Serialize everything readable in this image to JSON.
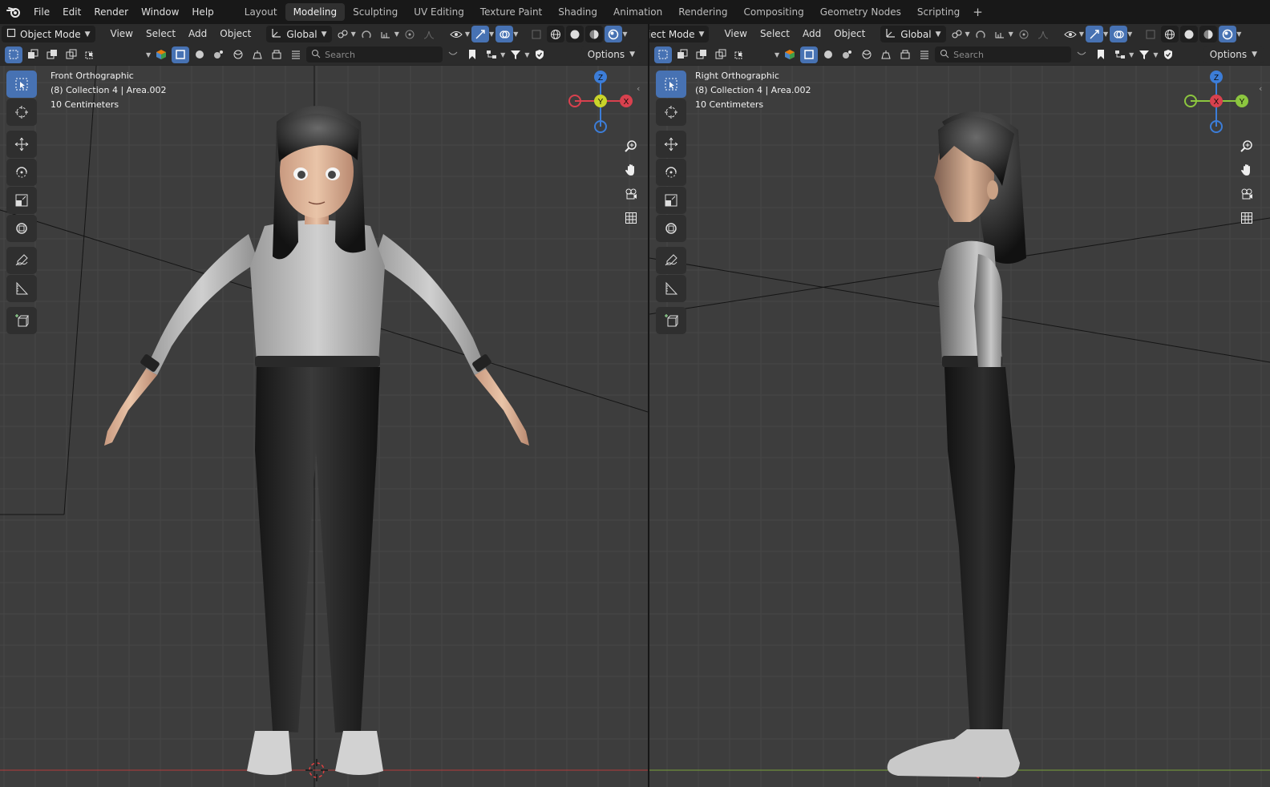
{
  "topbar": {
    "menus": [
      "File",
      "Edit",
      "Render",
      "Window",
      "Help"
    ],
    "workspaces": [
      "Layout",
      "Modeling",
      "Sculpting",
      "UV Editing",
      "Texture Paint",
      "Shading",
      "Animation",
      "Rendering",
      "Compositing",
      "Geometry Nodes",
      "Scripting"
    ],
    "active_workspace": "Modeling",
    "add_label": "+"
  },
  "left": {
    "mode_label": "Object Mode",
    "menus": [
      "View",
      "Select",
      "Add",
      "Object"
    ],
    "orientation": "Global",
    "search_placeholder": "Search",
    "options_label": "Options",
    "overlay": {
      "view_name": "Front Orthographic",
      "collection": "(8) Collection 4 | Area.002",
      "scale": "10 Centimeters"
    },
    "gizmo": {
      "top": "Z",
      "center": "Y",
      "left": "",
      "right": "X"
    },
    "floor_axis_color": "#b53a3a"
  },
  "right": {
    "mode_label": "ject Mode",
    "menus": [
      "View",
      "Select",
      "Add",
      "Object"
    ],
    "orientation": "Global",
    "search_placeholder": "Search",
    "options_label": "Options",
    "overlay": {
      "view_name": "Right Orthographic",
      "collection": "(8) Collection 4 | Area.002",
      "scale": "10 Centimeters"
    },
    "gizmo": {
      "top": "Z",
      "center": "X",
      "left": "",
      "right": "Y"
    },
    "floor_axis_color": "#7aa33a"
  },
  "colors": {
    "accent": "#4772b3",
    "viewport_bg": "#3d3d3d",
    "axis_x": "#d9414e",
    "axis_y": "#8cc63f",
    "axis_y_center": "#c9d42a",
    "axis_z": "#3c7dd8"
  },
  "icons": {
    "tools": [
      "select-box-icon",
      "cursor-icon",
      "move-icon",
      "rotate-icon",
      "scale-icon",
      "transform-icon",
      "annotate-icon",
      "measure-icon",
      "add-cube-icon"
    ],
    "nav": [
      "zoom-icon",
      "pan-hand-icon",
      "camera-icon",
      "grid-perspective-icon"
    ]
  }
}
